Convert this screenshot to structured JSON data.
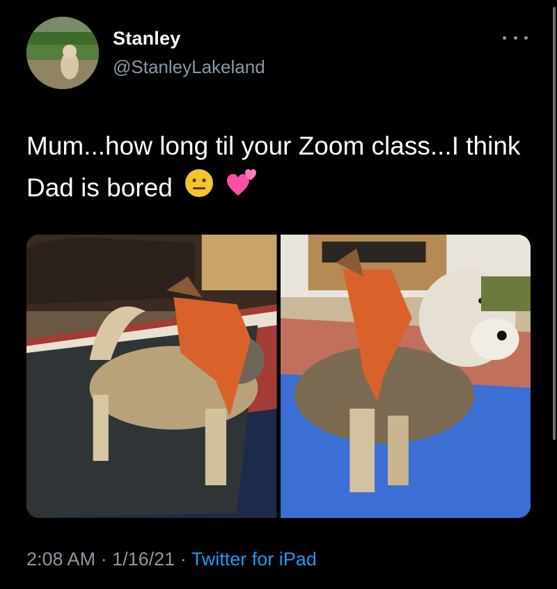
{
  "tweet": {
    "author_name": "Stanley",
    "author_handle": "@StanleyLakeland",
    "text": "Mum...how long til your Zoom class...I think Dad is bored",
    "emojis": [
      "neutral-face-emoji",
      "two-hearts-emoji"
    ],
    "time": "2:08 AM",
    "separator": "·",
    "date": "1/16/21",
    "source": "Twitter for iPad",
    "photos_count": 2
  },
  "colors": {
    "background": "#000000",
    "secondary_text": "#8b98a5",
    "link": "#1d9bf0",
    "yoga_mat_left": "#2f3436",
    "yoga_mat_right": "#3b6fd6",
    "toy": "#d9622b"
  }
}
